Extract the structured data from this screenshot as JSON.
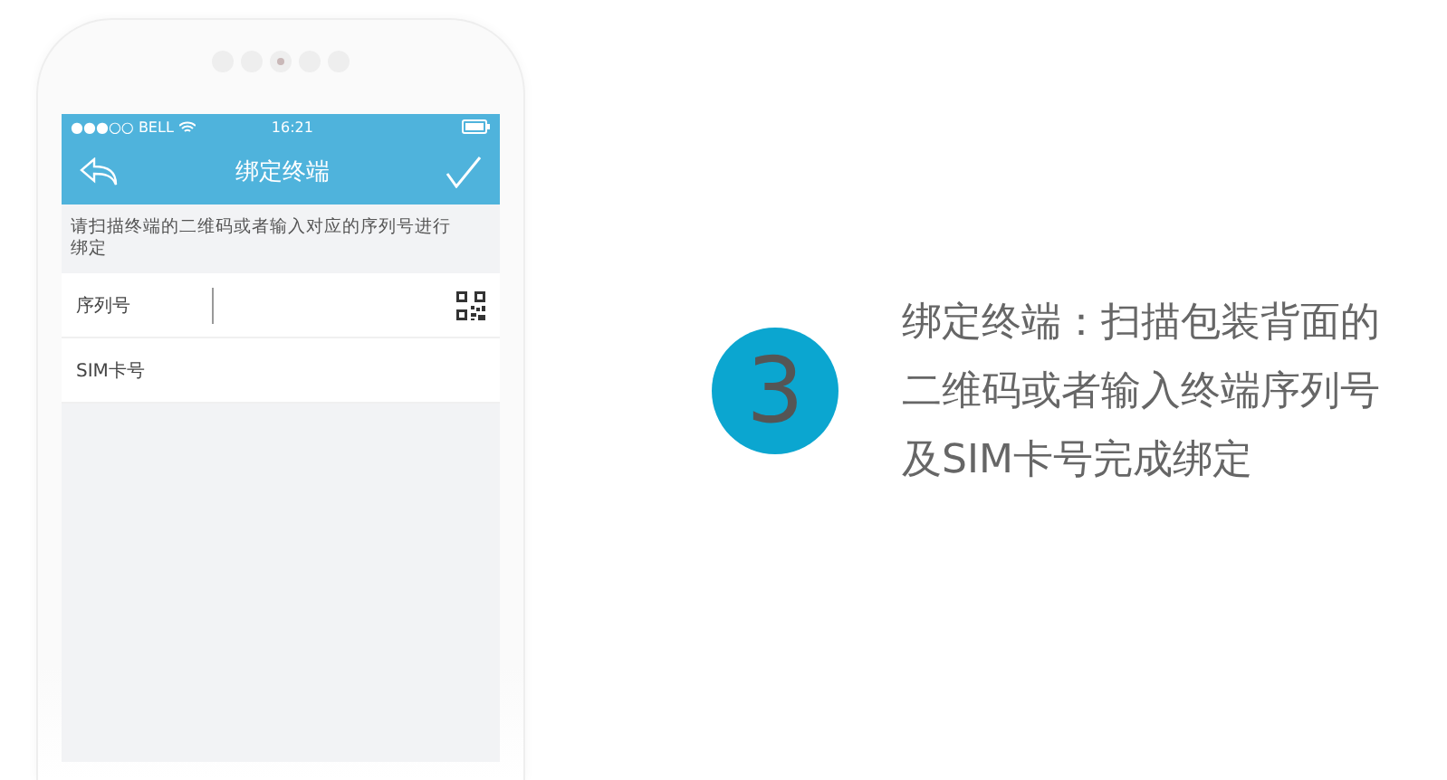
{
  "phone": {
    "page_dots": [
      {
        "selected": false
      },
      {
        "selected": false
      },
      {
        "selected": true
      },
      {
        "selected": false
      },
      {
        "selected": false
      }
    ],
    "status_bar": {
      "carrier": "●●●○○ BELL",
      "time": "16:21"
    },
    "nav_bar": {
      "title": "绑定终端"
    },
    "hint": "请扫描终端的二维码或者输入对应的序列号进行绑定",
    "fields": [
      {
        "label": "序列号",
        "kind": "scan"
      },
      {
        "label": "SIM卡号",
        "kind": "plain"
      }
    ]
  },
  "step": {
    "number": "3",
    "lines": [
      "绑定终端：扫描包装背面的",
      "二维码或者输入终端序列号",
      "及SIM卡号完成绑定"
    ]
  }
}
